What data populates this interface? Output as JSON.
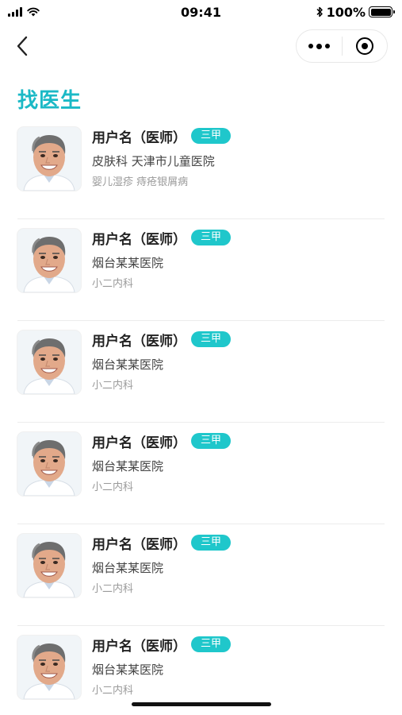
{
  "status_bar": {
    "time": "09:41",
    "battery": "100%"
  },
  "nav": {
    "back_icon": "chevron-left-icon",
    "more_icon": "more-dots-icon",
    "close_icon": "target-circle-icon"
  },
  "page": {
    "title": "找医生"
  },
  "colors": {
    "accent": "#1bb9c6",
    "badge": "#1fc7cb"
  },
  "doctors": [
    {
      "name": "用户名（医师）",
      "grade": "三甲",
      "hospital": "皮肤科 天津市儿童医院",
      "specialty": "婴儿湿疹 痔疮银屑病"
    },
    {
      "name": "用户名（医师）",
      "grade": "三甲",
      "hospital": "烟台某某医院",
      "specialty": "小二内科"
    },
    {
      "name": "用户名（医师）",
      "grade": "三甲",
      "hospital": "烟台某某医院",
      "specialty": "小二内科"
    },
    {
      "name": "用户名（医师）",
      "grade": "三甲",
      "hospital": "烟台某某医院",
      "specialty": "小二内科"
    },
    {
      "name": "用户名（医师）",
      "grade": "三甲",
      "hospital": "烟台某某医院",
      "specialty": "小二内科"
    },
    {
      "name": "用户名（医师）",
      "grade": "三甲",
      "hospital": "烟台某某医院",
      "specialty": "小二内科"
    }
  ]
}
